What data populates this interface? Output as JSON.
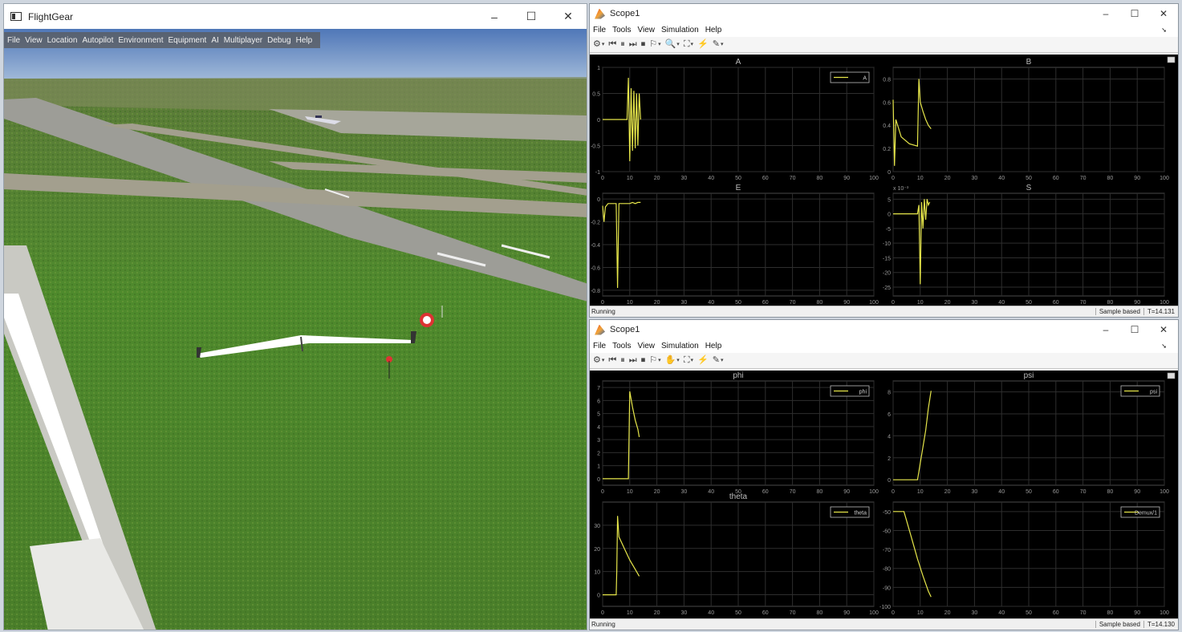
{
  "flightgear": {
    "title": "FlightGear",
    "controls": [
      "–",
      "☐",
      "✕"
    ],
    "menu": [
      "File",
      "View",
      "Location",
      "Autopilot",
      "Environment",
      "Equipment",
      "AI",
      "Multiplayer",
      "Debug",
      "Help"
    ]
  },
  "scopes": [
    {
      "title": "Scope1",
      "controls": [
        "–",
        "☐",
        "✕"
      ],
      "menu": [
        "File",
        "Tools",
        "View",
        "Simulation",
        "Help"
      ],
      "status_left": "Running",
      "status_mode": "Sample based",
      "status_time": "T=14.131"
    },
    {
      "title": "Scope1",
      "controls": [
        "–",
        "☐",
        "✕"
      ],
      "menu": [
        "File",
        "Tools",
        "View",
        "Simulation",
        "Help"
      ],
      "status_left": "Running",
      "status_mode": "Sample based",
      "status_time": "T=14.130"
    }
  ],
  "chart_data": [
    {
      "type": "line",
      "title": "A",
      "legend": "A",
      "legend_position": "top-right",
      "xlim": [
        0,
        100
      ],
      "ylim": [
        -1,
        1
      ],
      "xticks": [
        "0",
        "10",
        "20",
        "30",
        "40",
        "50",
        "60",
        "70",
        "80",
        "90",
        "100"
      ],
      "yticks": [
        "1",
        "0.5",
        "0",
        "-0.5",
        "-1"
      ],
      "series": [
        {
          "name": "A",
          "x": [
            0,
            9,
            9.5,
            10,
            10.5,
            11,
            11.5,
            12,
            12.5,
            13,
            13.5,
            14
          ],
          "y": [
            0,
            0,
            0.8,
            -0.8,
            0.6,
            -0.6,
            0.55,
            -0.55,
            0.5,
            -0.5,
            0.5,
            0
          ]
        }
      ]
    },
    {
      "type": "line",
      "title": "B",
      "legend_position": "none",
      "xlim": [
        0,
        100
      ],
      "ylim": [
        0,
        0.9
      ],
      "xticks": [
        "0",
        "10",
        "20",
        "30",
        "40",
        "50",
        "60",
        "70",
        "80",
        "90",
        "100"
      ],
      "yticks": [
        "0.8",
        "0.6",
        "0.4",
        "0.2",
        "0"
      ],
      "series": [
        {
          "name": "",
          "x": [
            0,
            0.5,
            1,
            3,
            6,
            9,
            9.5,
            10,
            11,
            12,
            13,
            14
          ],
          "y": [
            0.62,
            0.05,
            0.45,
            0.3,
            0.24,
            0.22,
            0.8,
            0.6,
            0.52,
            0.45,
            0.4,
            0.37
          ]
        }
      ]
    },
    {
      "type": "line",
      "title": "E",
      "legend_position": "none",
      "xlim": [
        0,
        100
      ],
      "ylim": [
        -0.85,
        0.05
      ],
      "xticks": [
        "0",
        "10",
        "20",
        "30",
        "40",
        "50",
        "60",
        "70",
        "80",
        "90",
        "100"
      ],
      "yticks": [
        "0",
        "-0.2",
        "-0.4",
        "-0.6",
        "-0.8"
      ],
      "series": [
        {
          "name": "",
          "x": [
            0,
            0.5,
            1,
            2,
            5,
            5.5,
            6,
            7,
            10,
            11,
            12,
            13,
            14
          ],
          "y": [
            -0.06,
            -0.2,
            -0.07,
            -0.04,
            -0.04,
            -0.78,
            -0.04,
            -0.04,
            -0.04,
            -0.03,
            -0.04,
            -0.03,
            -0.03
          ]
        }
      ]
    },
    {
      "type": "line",
      "title": "S",
      "legend_position": "none",
      "exponent_label": "x 10⁻³",
      "xlim": [
        0,
        100
      ],
      "ylim": [
        -28,
        7
      ],
      "xticks": [
        "0",
        "10",
        "20",
        "30",
        "40",
        "50",
        "60",
        "70",
        "80",
        "90",
        "100"
      ],
      "yticks": [
        "5",
        "0",
        "-5",
        "-10",
        "-15",
        "-20",
        "-25"
      ],
      "series": [
        {
          "name": "",
          "x": [
            0,
            9,
            9.5,
            10,
            10.5,
            11,
            11.5,
            12,
            12.5,
            13,
            13.5
          ],
          "y": [
            0,
            0,
            3,
            -24,
            4,
            -5,
            5,
            -2,
            5,
            3,
            4
          ]
        }
      ]
    },
    {
      "type": "line",
      "title": "phi",
      "legend": "phi",
      "legend_position": "top-right",
      "xlim": [
        0,
        100
      ],
      "ylim": [
        -0.5,
        7.5
      ],
      "xticks": [
        "0",
        "10",
        "20",
        "30",
        "40",
        "50",
        "60",
        "70",
        "80",
        "90",
        "100"
      ],
      "yticks": [
        "7",
        "6",
        "5",
        "4",
        "3",
        "2",
        "1",
        "0"
      ],
      "series": [
        {
          "name": "phi",
          "x": [
            0,
            9.5,
            9.8,
            10,
            11,
            12,
            13,
            13.5
          ],
          "y": [
            0,
            0,
            4,
            6.7,
            5.5,
            4.5,
            3.8,
            3.2
          ]
        }
      ]
    },
    {
      "type": "line",
      "title": "psi",
      "legend": "psi",
      "legend_position": "top-right",
      "xlim": [
        0,
        100
      ],
      "ylim": [
        -0.5,
        9
      ],
      "xticks": [
        "0",
        "10",
        "20",
        "30",
        "40",
        "50",
        "60",
        "70",
        "80",
        "90",
        "100"
      ],
      "yticks": [
        "8",
        "6",
        "4",
        "2",
        "0"
      ],
      "series": [
        {
          "name": "psi",
          "x": [
            0,
            9,
            10,
            11,
            12,
            13,
            14
          ],
          "y": [
            0,
            0,
            1.5,
            3,
            4.5,
            6.5,
            8.1
          ]
        }
      ]
    },
    {
      "type": "line",
      "title": "theta",
      "legend": "theta",
      "legend_position": "top-right",
      "xlim": [
        0,
        100
      ],
      "ylim": [
        -5,
        40
      ],
      "xticks": [
        "0",
        "10",
        "20",
        "30",
        "40",
        "50",
        "60",
        "70",
        "80",
        "90",
        "100"
      ],
      "yticks": [
        "30",
        "20",
        "10",
        "0"
      ],
      "series": [
        {
          "name": "theta",
          "x": [
            0,
            5,
            5.2,
            5.5,
            6,
            8,
            10,
            12,
            13.5
          ],
          "y": [
            0,
            0,
            10,
            34,
            25,
            20,
            15,
            11,
            8
          ]
        }
      ]
    },
    {
      "type": "line",
      "title": "",
      "legend": "Demux/1",
      "legend_position": "top-right",
      "xlim": [
        0,
        100
      ],
      "ylim": [
        -100,
        -45
      ],
      "xticks": [
        "0",
        "10",
        "20",
        "30",
        "40",
        "50",
        "60",
        "70",
        "80",
        "90",
        "100"
      ],
      "yticks": [
        "-50",
        "-60",
        "-70",
        "-80",
        "-90",
        "-100"
      ],
      "series": [
        {
          "name": "Demux/1",
          "x": [
            0,
            4,
            5,
            7,
            9,
            11,
            13,
            14
          ],
          "y": [
            -50,
            -50,
            -55,
            -65,
            -75,
            -84,
            -92,
            -95
          ]
        }
      ]
    }
  ]
}
